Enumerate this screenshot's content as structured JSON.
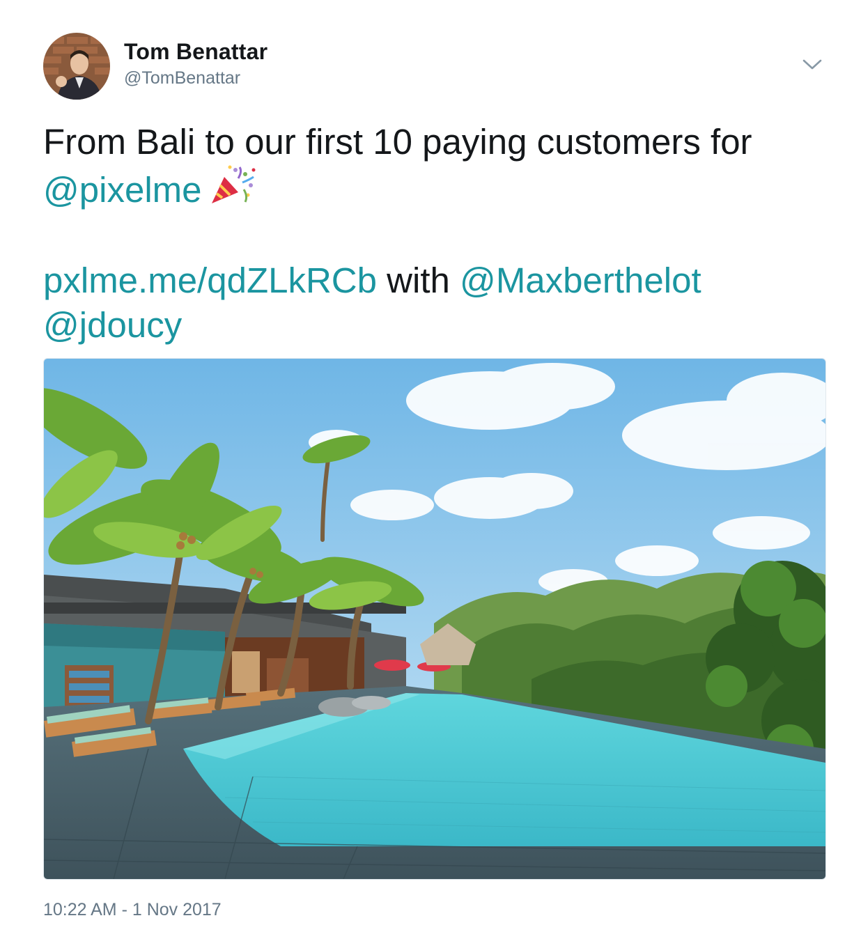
{
  "author": {
    "name": "Tom Benattar",
    "handle": "@TomBenattar"
  },
  "tweet": {
    "line1": "From Bali to our first 10 paying customers for",
    "mention_pixelme": "@pixelme",
    "emoji": "party-popper-icon",
    "link": "pxlme.me/qdZLkRCb",
    "with_text": " with ",
    "mention_max": "@Maxberthelot",
    "mention_jdoucy": "@jdoucy"
  },
  "media": {
    "icon": "photo-infinity-pool-jungle"
  },
  "timestamp": "10:22 AM - 1 Nov 2017",
  "colors": {
    "link": "#1b95a0",
    "text": "#14171a",
    "secondary": "#657786",
    "border": "#e1e8ed"
  }
}
